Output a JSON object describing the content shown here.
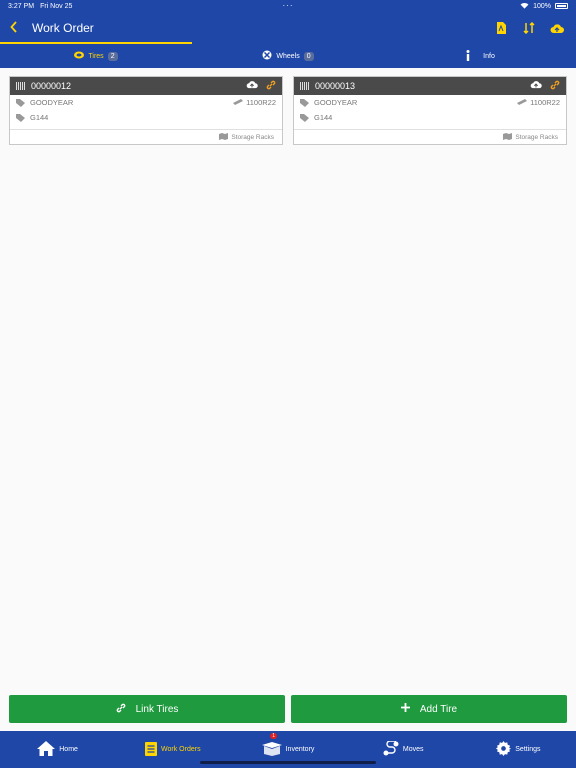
{
  "status": {
    "time": "3:27 PM",
    "date": "Fri Nov 25",
    "battery": "100%"
  },
  "nav": {
    "title": "Work Order",
    "back_icon": "chevron-left-icon",
    "icons": [
      "pdf-icon",
      "sort-icon",
      "cloud-upload-icon"
    ]
  },
  "tabs": [
    {
      "label": "Tires",
      "count": "2",
      "icon": "tire-icon",
      "active": true
    },
    {
      "label": "Wheels",
      "count": "0",
      "icon": "wheel-icon",
      "active": false
    },
    {
      "label": "Info",
      "count": "",
      "icon": "info-icon",
      "active": false
    }
  ],
  "cards": [
    {
      "id": "00000012",
      "brand": "GOODYEAR",
      "size": "1100R22",
      "model": "G144",
      "location": "Storage Racks"
    },
    {
      "id": "00000013",
      "brand": "GOODYEAR",
      "size": "1100R22",
      "model": "G144",
      "location": "Storage Racks"
    }
  ],
  "buttons": {
    "link_tires": "Link Tires",
    "add_tire": "Add Tire"
  },
  "bottom_nav": [
    {
      "label": "Home",
      "icon": "home-icon"
    },
    {
      "label": "Work Orders",
      "icon": "clipboard-icon",
      "badge": "1",
      "active": true
    },
    {
      "label": "Inventory",
      "icon": "box-icon"
    },
    {
      "label": "Moves",
      "icon": "route-icon"
    },
    {
      "label": "Settings",
      "icon": "gear-icon"
    }
  ],
  "colors": {
    "primary": "#1f47a8",
    "accent": "#ffd400",
    "button": "#1f9a3f",
    "card_header": "#4a4a4a"
  }
}
